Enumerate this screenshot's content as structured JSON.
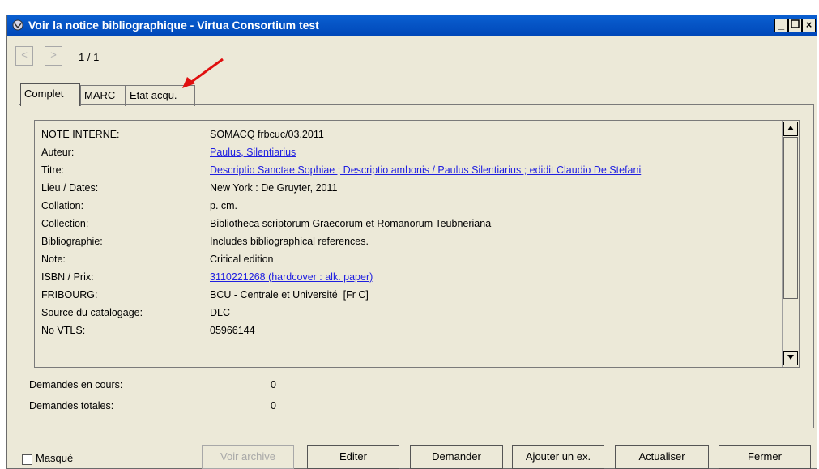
{
  "window": {
    "title": "Voir la notice bibliographique - Virtua Consortium test"
  },
  "nav": {
    "prev": "<",
    "next": ">",
    "pager": "1 / 1"
  },
  "tabs": [
    {
      "label": "Complet"
    },
    {
      "label": "MARC"
    },
    {
      "label": "Etat acqu."
    }
  ],
  "record": {
    "rows": [
      {
        "label": "NOTE INTERNE:",
        "value": "SOMACQ frbcuc/03.2011"
      },
      {
        "label": "Auteur:",
        "value": "Paulus, Silentiarius"
      },
      {
        "label": "Titre:",
        "value": "Descriptio Sanctae Sophiae ; Descriptio ambonis / Paulus Silentiarius ; edidit Claudio De Stefani"
      },
      {
        "label": "Lieu / Dates:",
        "value": "New York : De Gruyter, 2011"
      },
      {
        "label": "Collation:",
        "value": "p. cm."
      },
      {
        "label": "Collection:",
        "value": "Bibliotheca scriptorum Graecorum et Romanorum Teubneriana"
      },
      {
        "label": "Bibliographie:",
        "value": "Includes bibliographical references."
      },
      {
        "label": "Note:",
        "value": "Critical edition"
      },
      {
        "label": "ISBN / Prix:",
        "value": "3110221268 (hardcover : alk. paper)"
      },
      {
        "label": "FRIBOURG:",
        "value": "BCU - Centrale et Université  [Fr C]"
      },
      {
        "label": "Source du catalogage:",
        "value": "DLC"
      },
      {
        "label": "No VTLS:",
        "value": "05966144"
      }
    ]
  },
  "stats": {
    "current_label": "Demandes en cours:",
    "current_value": "0",
    "total_label": "Demandes totales:",
    "total_value": "0"
  },
  "footer": {
    "hidden_label": "Masqué",
    "buttons": {
      "archive": "Voir archive",
      "edit": "Editer",
      "request": "Demander",
      "add_copy": "Ajouter un ex.",
      "refresh": "Actualiser",
      "close": "Fermer"
    }
  },
  "colors": {
    "titlebar": "#0a5fd0",
    "link": "#1f1fe0",
    "annotation_arrow": "#e01010"
  }
}
